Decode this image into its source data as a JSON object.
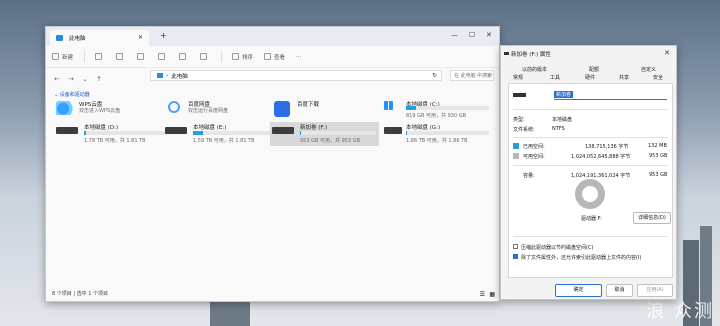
{
  "explorer": {
    "tab_title": "此电脑",
    "toolbar": {
      "new": "新建",
      "sort": "排序",
      "view": "查看",
      "more": "···"
    },
    "address": "此电脑",
    "search_placeholder": "在 此电脑 中搜索",
    "section": "设备和驱动器",
    "clouds": [
      {
        "name": "WPS云盘",
        "sub": "双击进入WPS云盘"
      },
      {
        "name": "百度网盘",
        "sub": "双击运行百度网盘"
      },
      {
        "name": "百度下载",
        "sub": ""
      }
    ],
    "drives": [
      {
        "name": "本地磁盘 (C:)",
        "space": "819 GB 可用，共 930 GB",
        "used": 0.12
      },
      {
        "name": "本地磁盘 (D:)",
        "space": "1.78 TB 可用，共 1.81 TB",
        "used": 0.02
      },
      {
        "name": "本地磁盘 (E:)",
        "space": "1.59 TB 可用，共 1.81 TB",
        "used": 0.12
      },
      {
        "name": "新加卷 (F:)",
        "space": "953 GB 可用，共 953 GB",
        "used": 0.0
      },
      {
        "name": "本地磁盘 (G:)",
        "space": "1.86 TB 可用，共 1.86 TB",
        "used": 0.0
      }
    ],
    "status_count": "8 个项目",
    "status_selected": "选中 1 个项目"
  },
  "props": {
    "title": "新加卷 (F:) 属性",
    "tabs_top": [
      "以前的版本",
      "配额",
      "自定义"
    ],
    "tabs_bottom": [
      "常规",
      "工具",
      "硬件",
      "共享",
      "安全"
    ],
    "volume_name": "新加卷",
    "type_label": "类型:",
    "type_value": "本地磁盘",
    "fs_label": "文件系统:",
    "fs_value": "NTFS",
    "used_label": "已用空间:",
    "used_bytes": "138,715,136 字节",
    "used_size": "132 MB",
    "free_label": "可用空间:",
    "free_bytes": "1,024,052,645,888 字节",
    "free_size": "953 GB",
    "cap_label": "容量:",
    "cap_bytes": "1,024,191,361,024 字节",
    "cap_size": "953 GB",
    "drive_label": "驱动器 F:",
    "cleanup": "详细信息(D)",
    "compress": "压缩此驱动器以节约磁盘空间(C)",
    "index": "除了文件属性外，还允许索引此驱动器上文件的内容(I)",
    "ok": "确定",
    "cancel": "取消",
    "apply": "应用(A)"
  },
  "colors": {
    "used": "#26a0da",
    "free": "#b7b7b7",
    "accent": "#2a6fd6"
  },
  "watermark": "新\n浪 众测"
}
